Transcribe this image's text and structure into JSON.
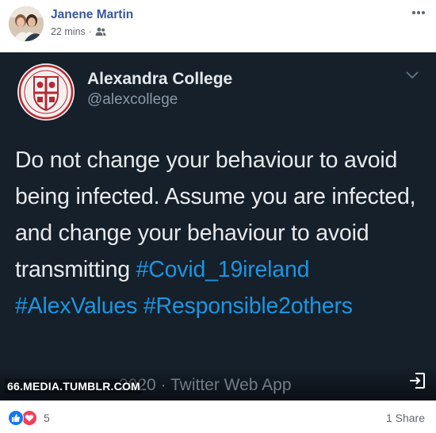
{
  "post": {
    "author": "Janene Martin",
    "time": "22 mins",
    "separator": "·",
    "audience_icon": "friends-icon"
  },
  "tweet": {
    "account_name": "Alexandra College",
    "handle": "@alexcollege",
    "body_text": "Do not change your behaviour to avoid being infected. Assume you are infected, and change your behaviour to avoid transmitting",
    "hashtags": "#Covid_19ireland #AlexValues #Responsible2others",
    "date_source": "2020 · Twitter Web App",
    "watermark": "66.MEDIA.TUMBLR.COM",
    "background_color": "#15202b",
    "hashtag_color": "#1b95e0"
  },
  "reactions": {
    "count": "5",
    "shares": "1 Share",
    "types": [
      "like-icon",
      "love-icon"
    ]
  },
  "colors": {
    "author_link": "#385898",
    "meta_gray": "#616770",
    "like_blue": "#1877f2",
    "love_red": "#f33e58"
  }
}
